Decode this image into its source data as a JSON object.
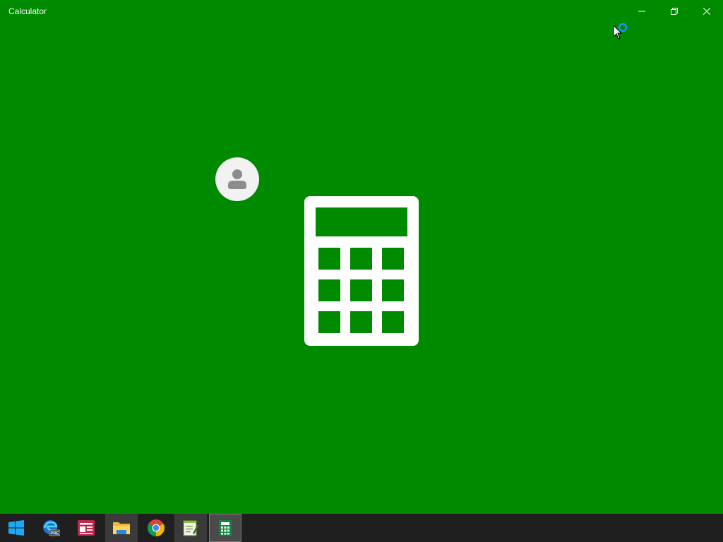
{
  "window": {
    "title": "Calculator",
    "background": "#008a00",
    "controls": {
      "minimize": "minimize-icon",
      "restore": "restore-icon",
      "close": "close-icon"
    }
  },
  "splash": {
    "icon": "calculator-icon",
    "avatar_icon": "user-avatar-icon",
    "cursor": "busy-cursor"
  },
  "taskbar": {
    "background": "#1f1f1f",
    "items": [
      {
        "name": "start",
        "icon": "windows-logo-icon",
        "state": "normal"
      },
      {
        "name": "edge-preview",
        "icon": "edge-pre-icon",
        "state": "normal"
      },
      {
        "name": "reader",
        "icon": "news-app-icon",
        "state": "normal"
      },
      {
        "name": "file-explorer",
        "icon": "folder-icon",
        "state": "running"
      },
      {
        "name": "chrome",
        "icon": "chrome-icon",
        "state": "normal"
      },
      {
        "name": "notepad",
        "icon": "notepad-icon",
        "state": "running"
      },
      {
        "name": "calculator",
        "icon": "calculator-icon",
        "state": "active"
      }
    ]
  }
}
